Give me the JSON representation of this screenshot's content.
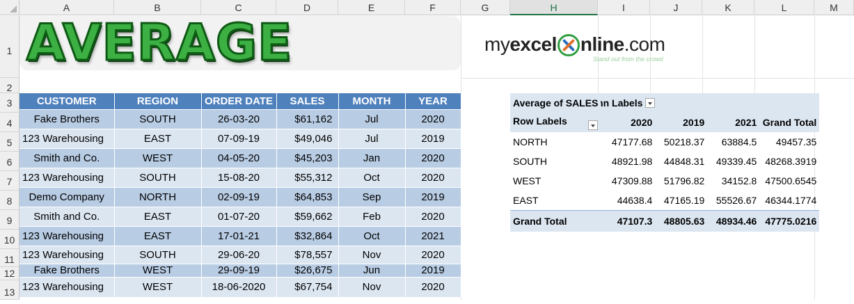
{
  "columns": [
    "A",
    "B",
    "C",
    "D",
    "E",
    "F",
    "G",
    "H",
    "I",
    "J",
    "K",
    "L",
    "M"
  ],
  "rows": [
    "1",
    "2",
    "3",
    "4",
    "5",
    "6",
    "7",
    "8",
    "9",
    "10",
    "11",
    "12",
    "13"
  ],
  "selected_column": "H",
  "banner": {
    "title": "AVERAGE",
    "title_color": "#3cb043"
  },
  "logo": {
    "part1": "my",
    "part2": "excel",
    "part3": "nline",
    "part4": ".com",
    "tagline": "Stand out from the crowd"
  },
  "data_table": {
    "headers": [
      "CUSTOMER",
      "REGION",
      "ORDER DATE",
      "SALES",
      "MONTH",
      "YEAR"
    ],
    "header_color": "#4f81bd",
    "rows": [
      [
        "Fake Brothers",
        "SOUTH",
        "26-03-20",
        "$61,162",
        "Jul",
        "2020"
      ],
      [
        "123 Warehousing",
        "EAST",
        "07-09-19",
        "$49,046",
        "Jul",
        "2019"
      ],
      [
        "Smith and Co.",
        "WEST",
        "04-05-20",
        "$45,203",
        "Jan",
        "2020"
      ],
      [
        "123 Warehousing",
        "SOUTH",
        "15-08-20",
        "$55,312",
        "Oct",
        "2020"
      ],
      [
        "Demo Company",
        "NORTH",
        "02-09-19",
        "$64,853",
        "Sep",
        "2019"
      ],
      [
        "Smith and Co.",
        "EAST",
        "01-07-20",
        "$59,662",
        "Feb",
        "2020"
      ],
      [
        "123 Warehousing",
        "EAST",
        "17-01-21",
        "$32,864",
        "Oct",
        "2021"
      ],
      [
        "123 Warehousing",
        "SOUTH",
        "29-06-20",
        "$78,557",
        "Nov",
        "2020"
      ],
      [
        "Fake Brothers",
        "WEST",
        "29-09-19",
        "$26,675",
        "Jun",
        "2019"
      ],
      [
        "123 Warehousing",
        "WEST",
        "18-06-2020",
        "$67,754",
        "Nov",
        "2020"
      ]
    ]
  },
  "pivot": {
    "value_label": "Average of SALES",
    "column_labels": "Column Labels",
    "row_labels": "Row Labels",
    "years": [
      "2020",
      "2019",
      "2021"
    ],
    "grand_total_label": "Grand Total",
    "rows": [
      {
        "label": "NORTH",
        "values": [
          "47177.68",
          "50218.37",
          "63884.5",
          "49457.35"
        ]
      },
      {
        "label": "SOUTH",
        "values": [
          "48921.98",
          "44848.31",
          "49339.45",
          "48268.3919"
        ]
      },
      {
        "label": "WEST",
        "values": [
          "47309.88",
          "51796.82",
          "34152.8",
          "47500.6545"
        ]
      },
      {
        "label": "EAST",
        "values": [
          "44638.4",
          "47165.19",
          "55526.67",
          "46344.1774"
        ]
      }
    ],
    "totals": [
      "47107.3",
      "48805.63",
      "48934.46",
      "47775.0216"
    ]
  }
}
